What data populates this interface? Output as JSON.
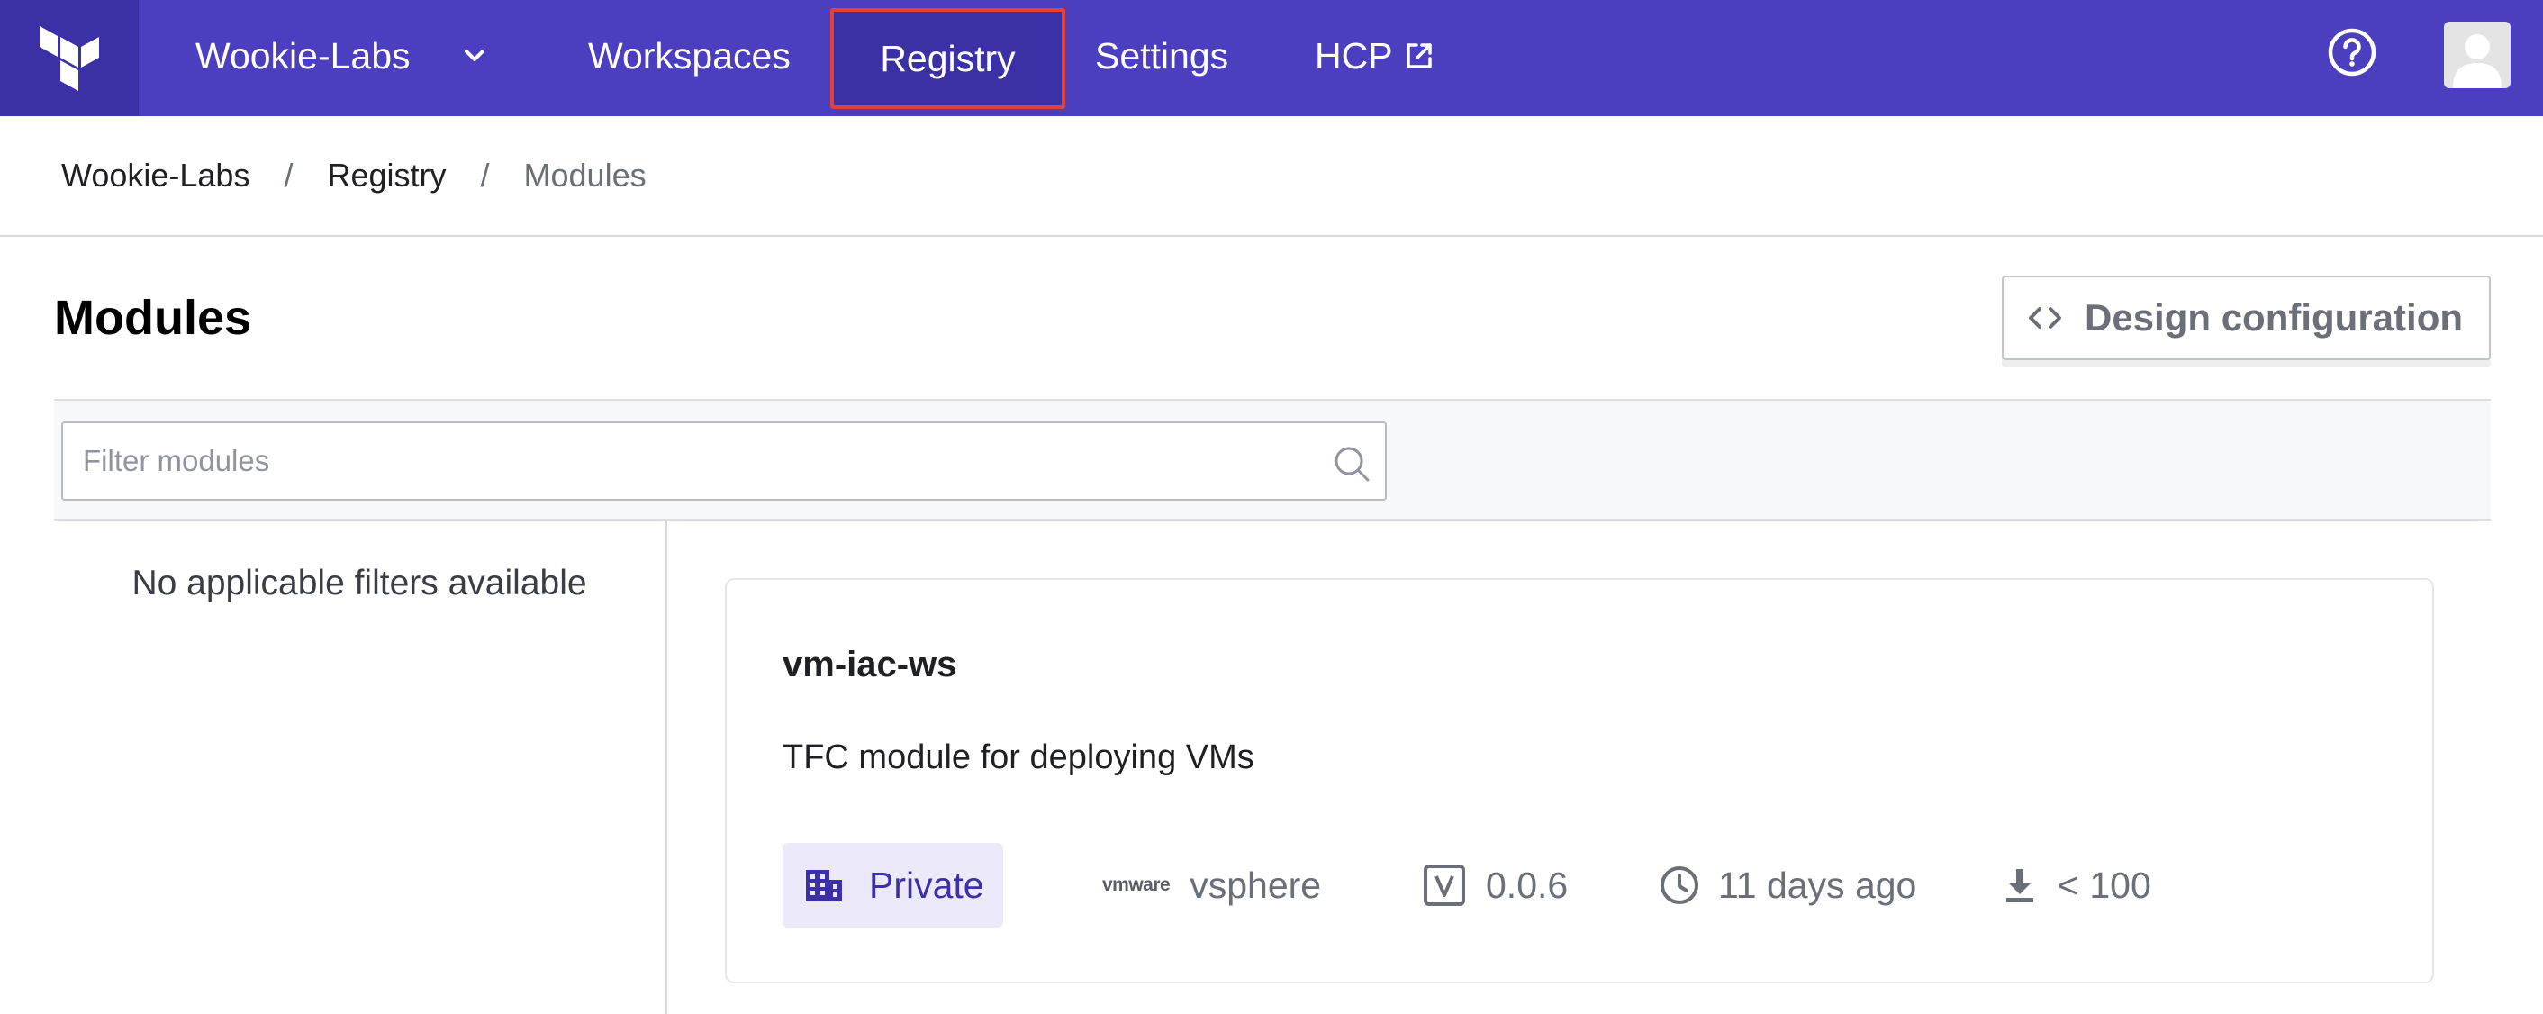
{
  "nav": {
    "org_name": "Wookie-Labs",
    "items": [
      {
        "label": "Workspaces"
      },
      {
        "label": "Registry",
        "active": true
      },
      {
        "label": "Settings"
      },
      {
        "label": "HCP",
        "external": true
      }
    ],
    "icons": [
      "terraform-logo-icon",
      "chevron-down-icon",
      "external-link-icon",
      "help-icon",
      "user-avatar-icon"
    ],
    "colors": {
      "nav_bg": "#4b3fbf",
      "nav_active_bg": "#3b30a6",
      "highlight_border": "#e0413a"
    }
  },
  "breadcrumb": {
    "items": [
      "Wookie-Labs",
      "Registry",
      "Modules"
    ],
    "separator": "/"
  },
  "header": {
    "title": "Modules",
    "design_button_label": "Design configuration"
  },
  "filter": {
    "value": "",
    "placeholder": "Filter modules"
  },
  "sidebar": {
    "empty_text": "No applicable filters available"
  },
  "modules": [
    {
      "name": "vm-iac-ws",
      "description": "TFC module for deploying VMs",
      "visibility": "Private",
      "provider_brand": "vmware",
      "provider": "vsphere",
      "version": "0.0.6",
      "updated": "11 days ago",
      "downloads": "< 100"
    }
  ]
}
